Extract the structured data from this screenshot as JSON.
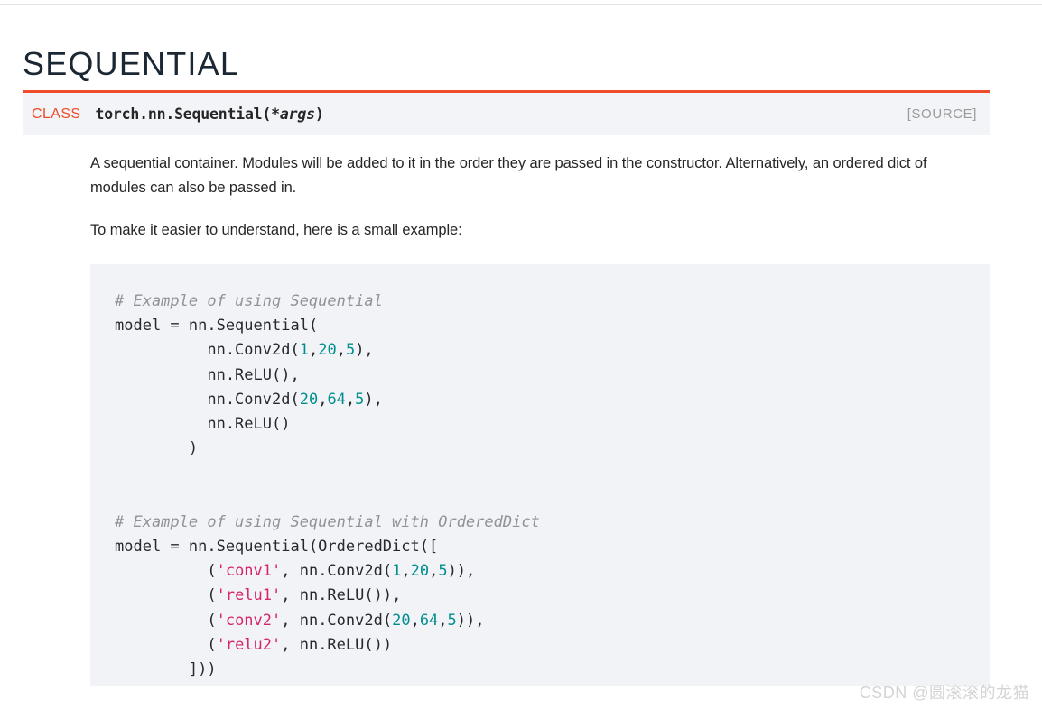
{
  "page": {
    "title": "SEQUENTIAL",
    "accent_color": "#ee4c2c",
    "code_bg_color": "#f2f3f7",
    "signature_bg_color": "#f3f4f7"
  },
  "signature": {
    "kind_label": "CLASS",
    "path": "torch.nn.Sequential(",
    "args": "*args",
    "close_paren": ")",
    "source_link": "[SOURCE]"
  },
  "description": {
    "paragraphs": [
      "A sequential container. Modules will be added to it in the order they are passed in the constructor. Alternatively, an ordered dict of modules can also be passed in.",
      "To make it easier to understand, here is a small example:"
    ]
  },
  "code": {
    "example1": {
      "comment": "# Example of using Sequential",
      "line_assign": "model = nn.Sequential(",
      "lines": [
        {
          "prefix": "          nn.Conv2d(",
          "nums": [
            "1",
            "20",
            "5"
          ],
          "suffix": "),"
        },
        {
          "prefix": "          nn.ReLU(),",
          "nums": [],
          "suffix": ""
        },
        {
          "prefix": "          nn.Conv2d(",
          "nums": [
            "20",
            "64",
            "5"
          ],
          "suffix": "),"
        },
        {
          "prefix": "          nn.ReLU()",
          "nums": [],
          "suffix": ""
        }
      ],
      "closing": "        )"
    },
    "example2": {
      "comment": "# Example of using Sequential with OrderedDict",
      "line_assign": "model = nn.Sequential(OrderedDict([",
      "lines": [
        {
          "indent": "          (",
          "string": "'conv1'",
          "mid": ", nn.Conv2d(",
          "nums": [
            "1",
            "20",
            "5"
          ],
          "suffix": ")),"
        },
        {
          "indent": "          (",
          "string": "'relu1'",
          "mid": ", nn.ReLU())",
          "nums": [],
          "suffix": ","
        },
        {
          "indent": "          (",
          "string": "'conv2'",
          "mid": ", nn.Conv2d(",
          "nums": [
            "20",
            "64",
            "5"
          ],
          "suffix": ")),"
        },
        {
          "indent": "          (",
          "string": "'relu2'",
          "mid": ", nn.ReLU())",
          "nums": [],
          "suffix": ""
        }
      ],
      "closing": "        ]))"
    }
  },
  "watermark": {
    "text": "CSDN @圆滚滚的龙猫"
  }
}
